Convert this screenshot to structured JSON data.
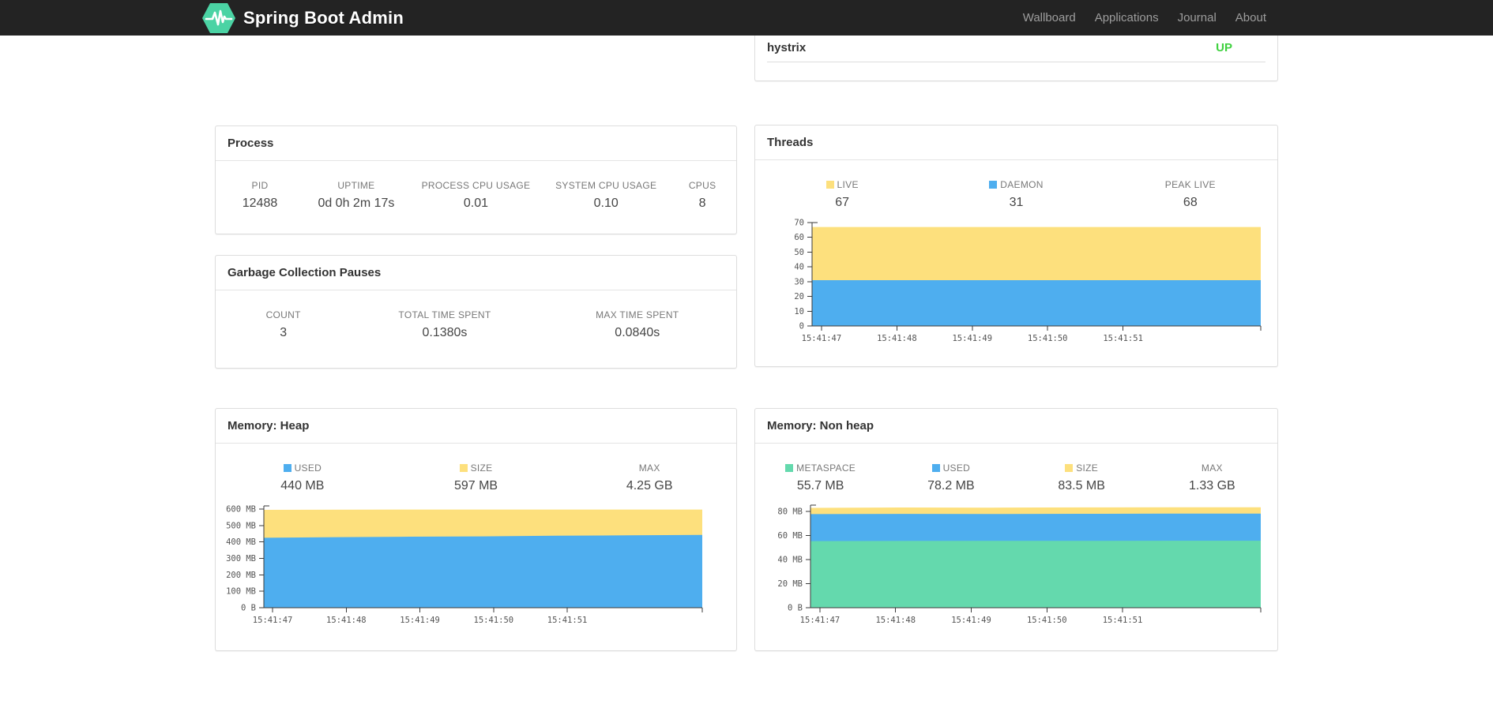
{
  "navbar": {
    "brand": "Spring Boot Admin",
    "items": [
      {
        "label": "Wallboard"
      },
      {
        "label": "Applications"
      },
      {
        "label": "Journal"
      },
      {
        "label": "About"
      }
    ]
  },
  "application_row": {
    "name": "hystrix",
    "status": "UP",
    "status_color": "#3fd13f"
  },
  "colors": {
    "yellow": "#fde07d",
    "blue": "#4eaeef",
    "green": "#64d9ad"
  },
  "panels": {
    "process": {
      "title": "Process",
      "metrics": [
        {
          "label": "PID",
          "value": "12488"
        },
        {
          "label": "UPTIME",
          "value": "0d 0h 2m 17s"
        },
        {
          "label": "PROCESS CPU USAGE",
          "value": "0.01"
        },
        {
          "label": "SYSTEM CPU USAGE",
          "value": "0.10"
        },
        {
          "label": "CPUS",
          "value": "8"
        }
      ]
    },
    "gc": {
      "title": "Garbage Collection Pauses",
      "metrics": [
        {
          "label": "COUNT",
          "value": "3"
        },
        {
          "label": "TOTAL TIME SPENT",
          "value": "0.1380s"
        },
        {
          "label": "MAX TIME SPENT",
          "value": "0.0840s"
        }
      ]
    },
    "threads": {
      "title": "Threads",
      "metrics": [
        {
          "label": "LIVE",
          "value": "67",
          "color": "#fde07d"
        },
        {
          "label": "DAEMON",
          "value": "31",
          "color": "#4eaeef"
        },
        {
          "label": "PEAK LIVE",
          "value": "68"
        }
      ]
    },
    "heap": {
      "title": "Memory: Heap",
      "metrics": [
        {
          "label": "USED",
          "value": "440 MB",
          "color": "#4eaeef"
        },
        {
          "label": "SIZE",
          "value": "597 MB",
          "color": "#fde07d"
        },
        {
          "label": "MAX",
          "value": "4.25 GB"
        }
      ]
    },
    "nonheap": {
      "title": "Memory: Non heap",
      "metrics": [
        {
          "label": "METASPACE",
          "value": "55.7 MB",
          "color": "#64d9ad"
        },
        {
          "label": "USED",
          "value": "78.2 MB",
          "color": "#4eaeef"
        },
        {
          "label": "SIZE",
          "value": "83.5 MB",
          "color": "#fde07d"
        },
        {
          "label": "MAX",
          "value": "1.33 GB"
        }
      ]
    }
  },
  "chart_data": [
    {
      "id": "threads",
      "type": "area",
      "title": "Threads",
      "unit": "threads",
      "x_labels": [
        "15:41:47",
        "15:41:48",
        "15:41:49",
        "15:41:50",
        "15:41:51"
      ],
      "ylim": [
        0,
        70
      ],
      "y_ticks": [
        {
          "value": 0,
          "label": "0"
        },
        {
          "value": 10,
          "label": "10"
        },
        {
          "value": 20,
          "label": "20"
        },
        {
          "value": 30,
          "label": "30"
        },
        {
          "value": 40,
          "label": "40"
        },
        {
          "value": 50,
          "label": "50"
        },
        {
          "value": 60,
          "label": "60"
        },
        {
          "value": 70,
          "label": "70"
        }
      ],
      "series": [
        {
          "name": "LIVE",
          "color": "#fde07d",
          "values": [
            67,
            67,
            67,
            67,
            67,
            67
          ]
        },
        {
          "name": "DAEMON",
          "color": "#4eaeef",
          "values": [
            31,
            31,
            31,
            31,
            31,
            31
          ]
        }
      ]
    },
    {
      "id": "heap",
      "type": "area",
      "title": "Memory: Heap",
      "unit": "MB",
      "x_labels": [
        "15:41:47",
        "15:41:48",
        "15:41:49",
        "15:41:50",
        "15:41:51"
      ],
      "ylim": [
        0,
        619
      ],
      "y_ticks": [
        {
          "value": 0,
          "label": "0 B"
        },
        {
          "value": 100,
          "label": "100 MB"
        },
        {
          "value": 200,
          "label": "200 MB"
        },
        {
          "value": 300,
          "label": "300 MB"
        },
        {
          "value": 400,
          "label": "400 MB"
        },
        {
          "value": 500,
          "label": "500 MB"
        },
        {
          "value": 600,
          "label": "600 MB"
        }
      ],
      "series": [
        {
          "name": "SIZE",
          "color": "#fde07d",
          "values": [
            595,
            596,
            597,
            597,
            597,
            597
          ]
        },
        {
          "name": "USED",
          "color": "#4eaeef",
          "values": [
            425,
            429,
            432,
            434,
            438,
            440,
            443
          ]
        }
      ]
    },
    {
      "id": "nonheap",
      "type": "area",
      "title": "Memory: Non heap",
      "unit": "MB",
      "x_labels": [
        "15:41:47",
        "15:41:48",
        "15:41:49",
        "15:41:50",
        "15:41:51"
      ],
      "ylim": [
        0,
        85.3
      ],
      "y_ticks": [
        {
          "value": 0,
          "label": "0 B"
        },
        {
          "value": 20,
          "label": "20 MB"
        },
        {
          "value": 40,
          "label": "40 MB"
        },
        {
          "value": 60,
          "label": "60 MB"
        },
        {
          "value": 80,
          "label": "80 MB"
        }
      ],
      "series": [
        {
          "name": "SIZE",
          "color": "#fde07d",
          "values": [
            83.0,
            83.3,
            83.2,
            83.4,
            83.5,
            83.5
          ]
        },
        {
          "name": "USED",
          "color": "#4eaeef",
          "values": [
            77.8,
            78.0,
            77.9,
            78.1,
            78.2,
            78.2
          ]
        },
        {
          "name": "METASPACE",
          "color": "#64d9ad",
          "values": [
            55.4,
            55.5,
            55.6,
            55.6,
            55.7,
            55.7
          ]
        }
      ]
    }
  ]
}
